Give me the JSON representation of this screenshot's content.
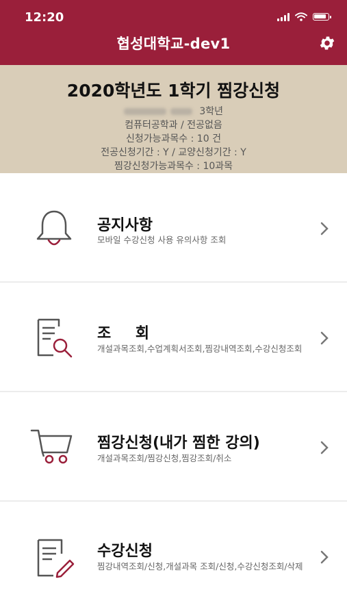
{
  "status": {
    "time": "12:20"
  },
  "header": {
    "title": "협성대학교-dev1"
  },
  "info": {
    "title": "2020학년도 1학기 찜강신청",
    "grade": "3학년",
    "major": "컴퓨터공학과 / 전공없음",
    "available_courses": "신청가능과목수 : 10 건",
    "periods": "전공신청기간 : Y / 교양신청기간 : Y",
    "wish_available": "찜강신청가능과목수 : 10과목"
  },
  "menu": [
    {
      "title": "공지사항",
      "desc": "모바일 수강신청 사용 유의사항 조회",
      "icon": "bell-icon"
    },
    {
      "title": "조 회",
      "desc": "개설과목조회,수업계획서조회,찜강내역조회,수강신청조회",
      "icon": "search-document-icon"
    },
    {
      "title": "찜강신청(내가 찜한 강의)",
      "desc": "개설과목조회/찜강신청,찜강조회/취소",
      "icon": "cart-icon"
    },
    {
      "title": "수강신청",
      "desc": "찜강내역조회/신청,개설과목 조회/신청,수강신청조회/삭제",
      "icon": "edit-document-icon"
    }
  ],
  "colors": {
    "header_bg": "#9a1f3a",
    "info_bg": "#d9cdb8",
    "accent": "#9a1f3a"
  }
}
